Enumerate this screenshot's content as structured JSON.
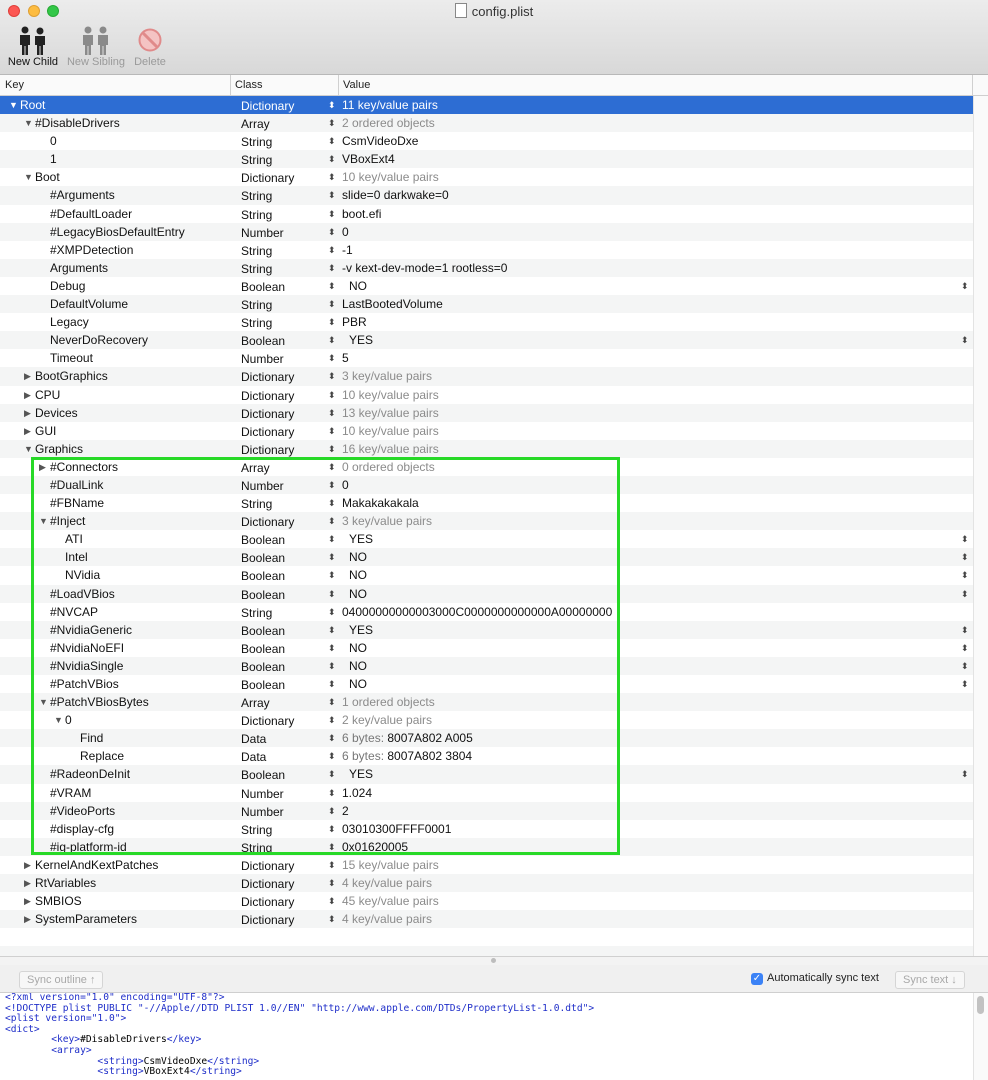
{
  "window": {
    "title": "config.plist"
  },
  "toolbar": {
    "new_child": "New Child",
    "new_sibling": "New Sibling",
    "delete": "Delete"
  },
  "columns": {
    "key": "Key",
    "class": "Class",
    "value": "Value"
  },
  "rows": [
    {
      "key": "Root",
      "class": "Dictionary",
      "value": "11 key/value pairs",
      "level": 0,
      "disc": "open",
      "summary": true,
      "selected": true
    },
    {
      "key": "#DisableDrivers",
      "class": "Array",
      "value": "2 ordered objects",
      "level": 1,
      "disc": "open",
      "summary": true
    },
    {
      "key": "0",
      "class": "String",
      "value": "CsmVideoDxe",
      "level": 2
    },
    {
      "key": "1",
      "class": "String",
      "value": "VBoxExt4",
      "level": 2
    },
    {
      "key": "Boot",
      "class": "Dictionary",
      "value": "10 key/value pairs",
      "level": 1,
      "disc": "open",
      "summary": true
    },
    {
      "key": "#Arguments",
      "class": "String",
      "value": "slide=0 darkwake=0",
      "level": 2
    },
    {
      "key": "#DefaultLoader",
      "class": "String",
      "value": "boot.efi",
      "level": 2
    },
    {
      "key": "#LegacyBiosDefaultEntry",
      "class": "Number",
      "value": "0",
      "level": 2
    },
    {
      "key": "#XMPDetection",
      "class": "String",
      "value": "-1",
      "level": 2
    },
    {
      "key": "Arguments",
      "class": "String",
      "value": "-v kext-dev-mode=1 rootless=0",
      "level": 2
    },
    {
      "key": "Debug",
      "class": "Boolean",
      "value": "NO",
      "level": 2,
      "bool": true
    },
    {
      "key": "DefaultVolume",
      "class": "String",
      "value": "LastBootedVolume",
      "level": 2
    },
    {
      "key": "Legacy",
      "class": "String",
      "value": "PBR",
      "level": 2
    },
    {
      "key": "NeverDoRecovery",
      "class": "Boolean",
      "value": "YES",
      "level": 2,
      "bool": true
    },
    {
      "key": "Timeout",
      "class": "Number",
      "value": "5",
      "level": 2
    },
    {
      "key": "BootGraphics",
      "class": "Dictionary",
      "value": "3 key/value pairs",
      "level": 1,
      "disc": "closed",
      "summary": true
    },
    {
      "key": "CPU",
      "class": "Dictionary",
      "value": "10 key/value pairs",
      "level": 1,
      "disc": "closed",
      "summary": true
    },
    {
      "key": "Devices",
      "class": "Dictionary",
      "value": "13 key/value pairs",
      "level": 1,
      "disc": "closed",
      "summary": true
    },
    {
      "key": "GUI",
      "class": "Dictionary",
      "value": "10 key/value pairs",
      "level": 1,
      "disc": "closed",
      "summary": true
    },
    {
      "key": "Graphics",
      "class": "Dictionary",
      "value": "16 key/value pairs",
      "level": 1,
      "disc": "open",
      "summary": true
    },
    {
      "key": "#Connectors",
      "class": "Array",
      "value": "0 ordered objects",
      "level": 2,
      "disc": "closed",
      "summary": true
    },
    {
      "key": "#DualLink",
      "class": "Number",
      "value": "0",
      "level": 2
    },
    {
      "key": "#FBName",
      "class": "String",
      "value": "Makakakakala",
      "level": 2
    },
    {
      "key": "#Inject",
      "class": "Dictionary",
      "value": "3 key/value pairs",
      "level": 2,
      "disc": "open",
      "summary": true
    },
    {
      "key": "ATI",
      "class": "Boolean",
      "value": "YES",
      "level": 3,
      "bool": true
    },
    {
      "key": "Intel",
      "class": "Boolean",
      "value": "NO",
      "level": 3,
      "bool": true
    },
    {
      "key": "NVidia",
      "class": "Boolean",
      "value": "NO",
      "level": 3,
      "bool": true
    },
    {
      "key": "#LoadVBios",
      "class": "Boolean",
      "value": "NO",
      "level": 2,
      "bool": true
    },
    {
      "key": "#NVCAP",
      "class": "String",
      "value": "04000000000003000C0000000000000A00000000",
      "level": 2
    },
    {
      "key": "#NvidiaGeneric",
      "class": "Boolean",
      "value": "YES",
      "level": 2,
      "bool": true
    },
    {
      "key": "#NvidiaNoEFI",
      "class": "Boolean",
      "value": "NO",
      "level": 2,
      "bool": true
    },
    {
      "key": "#NvidiaSingle",
      "class": "Boolean",
      "value": "NO",
      "level": 2,
      "bool": true
    },
    {
      "key": "#PatchVBios",
      "class": "Boolean",
      "value": "NO",
      "level": 2,
      "bool": true
    },
    {
      "key": "#PatchVBiosBytes",
      "class": "Array",
      "value": "1 ordered objects",
      "level": 2,
      "disc": "open",
      "summary": true
    },
    {
      "key": "0",
      "class": "Dictionary",
      "value": "2 key/value pairs",
      "level": 3,
      "disc": "open",
      "summary": true
    },
    {
      "key": "Find",
      "class": "Data",
      "value": "8007A802 A005",
      "data_label": "6 bytes: ",
      "level": 4
    },
    {
      "key": "Replace",
      "class": "Data",
      "value": "8007A802 3804",
      "data_label": "6 bytes: ",
      "level": 4
    },
    {
      "key": "#RadeonDeInit",
      "class": "Boolean",
      "value": "YES",
      "level": 2,
      "bool": true
    },
    {
      "key": "#VRAM",
      "class": "Number",
      "value": "1.024",
      "level": 2
    },
    {
      "key": "#VideoPorts",
      "class": "Number",
      "value": "2",
      "level": 2
    },
    {
      "key": "#display-cfg",
      "class": "String",
      "value": "03010300FFFF0001",
      "level": 2
    },
    {
      "key": "#ig-platform-id",
      "class": "String",
      "value": "0x01620005",
      "level": 2
    },
    {
      "key": "KernelAndKextPatches",
      "class": "Dictionary",
      "value": "15 key/value pairs",
      "level": 1,
      "disc": "closed",
      "summary": true
    },
    {
      "key": "RtVariables",
      "class": "Dictionary",
      "value": "4 key/value pairs",
      "level": 1,
      "disc": "closed",
      "summary": true
    },
    {
      "key": "SMBIOS",
      "class": "Dictionary",
      "value": "45 key/value pairs",
      "level": 1,
      "disc": "closed",
      "summary": true
    },
    {
      "key": "SystemParameters",
      "class": "Dictionary",
      "value": "4 key/value pairs",
      "level": 1,
      "disc": "closed",
      "summary": true
    },
    {
      "key": "",
      "class": "",
      "value": "",
      "level": 0
    },
    {
      "key": "",
      "class": "",
      "value": "",
      "level": 0
    }
  ],
  "sync": {
    "sync_outline": "Sync outline ↑",
    "auto_sync": "Automatically sync text",
    "auto_sync_checked": true,
    "sync_text": "Sync text ↓"
  },
  "xml_lines": [
    "<?xml version=\"1.0\" encoding=\"UTF-8\"?>",
    "<!DOCTYPE plist PUBLIC \"-//Apple//DTD PLIST 1.0//EN\" \"http://www.apple.com/DTDs/PropertyList-1.0.dtd\">",
    "<plist version=\"1.0\">",
    "<dict>",
    "        <key>#DisableDrivers</key>",
    "        <array>",
    "                <string>CsmVideoDxe</string>",
    "                <string>VBoxExt4</string>"
  ],
  "colors": {
    "selection": "#2d6dd3",
    "highlight_box": "#27d927",
    "xml_tag": "#1f2ec9"
  }
}
